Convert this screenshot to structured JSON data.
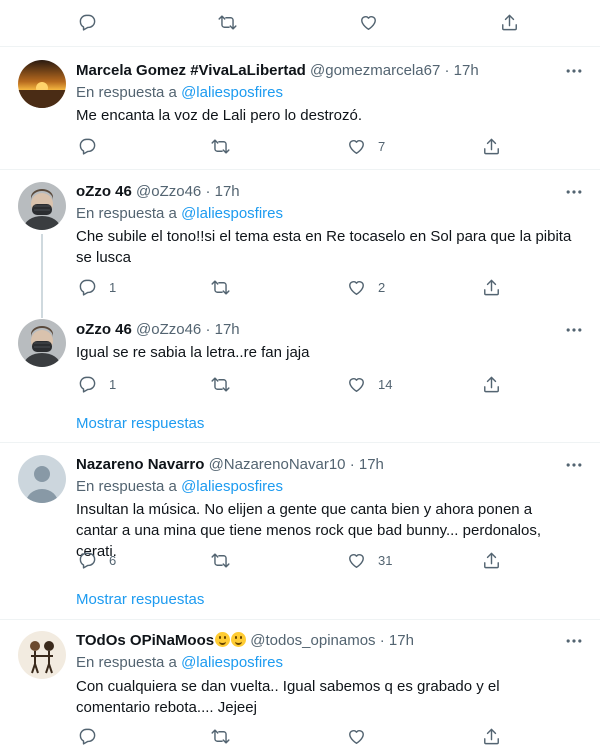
{
  "top_actions": {
    "reply_count": "",
    "retweet_count": "",
    "like_count": ""
  },
  "show_replies_label": "Mostrar respuestas",
  "tweets": [
    {
      "name": "Marcela Gomez #VivaLaLibertad",
      "handle": "@gomezmarcela67",
      "separator": "·",
      "time": "17h",
      "reply_prefix": "En respuesta a",
      "reply_to": "@laliesposfires",
      "text": "Me encanta la voz de Lali pero lo destrozó.",
      "replies": "",
      "retweets": "",
      "likes": "7"
    },
    {
      "name": "oZzo 46",
      "handle": "@oZzo46",
      "separator": "·",
      "time": "17h",
      "reply_prefix": "En respuesta a",
      "reply_to": "@laliesposfires",
      "text": "Che subile el tono!!si el tema esta en Re tocaselo en Sol para que la pibita se lusca",
      "replies": "1",
      "retweets": "",
      "likes": "2"
    },
    {
      "name": "oZzo 46",
      "handle": "@oZzo46",
      "separator": "·",
      "time": "17h",
      "text": "Igual se re sabia la letra..re fan jaja",
      "replies": "1",
      "retweets": "",
      "likes": "14"
    },
    {
      "name": "Nazareno Navarro",
      "handle": "@NazarenoNavar10",
      "separator": "·",
      "time": "17h",
      "reply_prefix": "En respuesta a",
      "reply_to": "@laliesposfires",
      "text": "Insultan la música. No elijen a gente que canta bien y ahora ponen a cantar a una mina que tiene menos rock que bad bunny... perdonalos, cerati.",
      "replies": "6",
      "retweets": "",
      "likes": "31"
    },
    {
      "name": "TOdOs OPiNaMoos",
      "handle": "@todos_opinamos",
      "separator": "·",
      "time": "17h",
      "reply_prefix": "En respuesta a",
      "reply_to": "@laliesposfires",
      "text": "Con cualquiera se dan vuelta.. Igual sabemos q es grabado y el comentario rebota.... Jejeej",
      "replies": "",
      "retweets": "",
      "likes": ""
    }
  ],
  "colors": {
    "accent": "#1d9bf0",
    "muted": "#536471",
    "divider": "#eff3f4",
    "thread": "#cfd9de"
  }
}
